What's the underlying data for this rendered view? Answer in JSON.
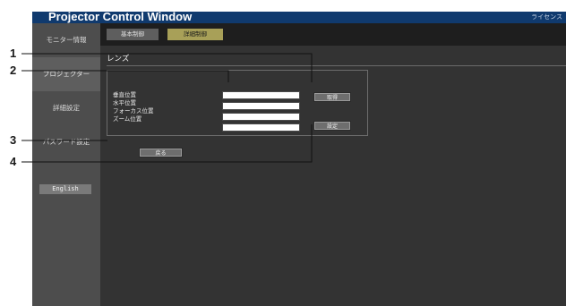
{
  "app": {
    "title": "Projector Control Window",
    "license_link": "ライセンス"
  },
  "tabs": {
    "basic": "基本制御",
    "detail": "詳細制御"
  },
  "sidebar": {
    "items": [
      {
        "label": "モニター情報"
      },
      {
        "label": "プロジェクター"
      },
      {
        "label": "詳細設定"
      },
      {
        "label": "パスワード設定"
      }
    ],
    "english_button": "English"
  },
  "section": {
    "title": "レンズ"
  },
  "fields": [
    {
      "label": "垂直位置",
      "value": ""
    },
    {
      "label": "水平位置",
      "value": ""
    },
    {
      "label": "フォーカス位置",
      "value": ""
    },
    {
      "label": "ズーム位置",
      "value": ""
    }
  ],
  "buttons": {
    "get": "取得",
    "set": "設定",
    "back": "戻る"
  },
  "callouts": [
    "1",
    "2",
    "3",
    "4"
  ],
  "colors": {
    "title_bar": "#103a6e",
    "active_tab": "#a8a058",
    "background": "#333333"
  }
}
